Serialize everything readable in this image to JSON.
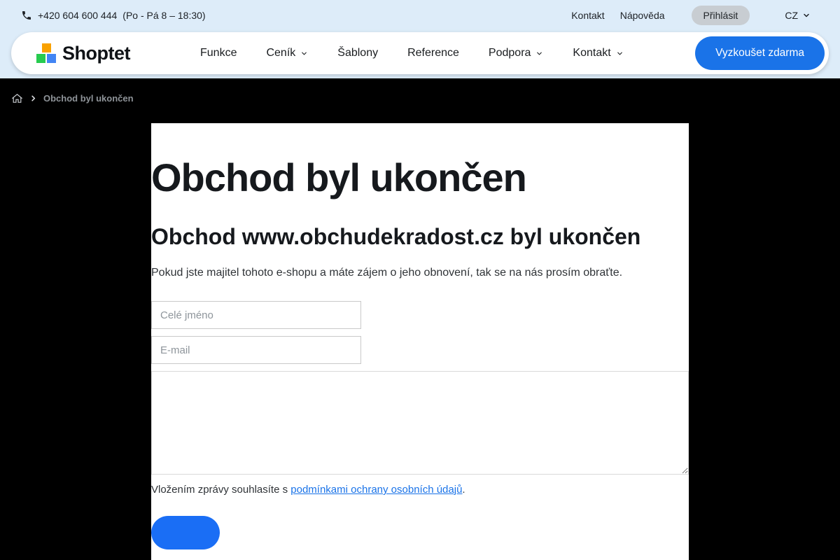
{
  "topbar": {
    "phone": "+420 604 600 444",
    "hours": "(Po - Pá 8 – 18:30)",
    "contact_label": "Kontakt",
    "help_label": "Nápověda",
    "login_label": "Přihlásit",
    "language": "CZ"
  },
  "navbar": {
    "brand": "Shoptet",
    "items": [
      {
        "label": "Funkce",
        "has_dropdown": false
      },
      {
        "label": "Ceník",
        "has_dropdown": true
      },
      {
        "label": "Šablony",
        "has_dropdown": false
      },
      {
        "label": "Reference",
        "has_dropdown": false
      },
      {
        "label": "Podpora",
        "has_dropdown": true
      },
      {
        "label": "Kontakt",
        "has_dropdown": true
      }
    ],
    "cta_label": "Vyzkoušet zdarma"
  },
  "breadcrumb": {
    "home_icon": "home-icon",
    "current": "Obchod byl ukončen"
  },
  "main": {
    "title": "Obchod byl ukončen",
    "subtitle": "Obchod www.obchudekradost.cz byl ukončen",
    "description": "Pokud jste majitel tohoto e-shopu a máte zájem o jeho obnovení, tak se na nás prosím obraťte.",
    "form": {
      "name_placeholder": "Celé jméno",
      "email_placeholder": "E-mail",
      "message_value": "",
      "consent_prefix": "Vložením zprávy souhlasíte s ",
      "consent_link": "podmínkami ochrany osobních údajů",
      "consent_suffix": ".",
      "submit_label": ""
    }
  },
  "colors": {
    "accent_blue": "#1a73e8",
    "topbar_bg": "#ddecf9",
    "page_bg": "#000000",
    "login_pill_bg": "#c8cdd2",
    "logo_orange": "#f9a100",
    "logo_green": "#27cb4f",
    "logo_blue": "#4285f4"
  }
}
